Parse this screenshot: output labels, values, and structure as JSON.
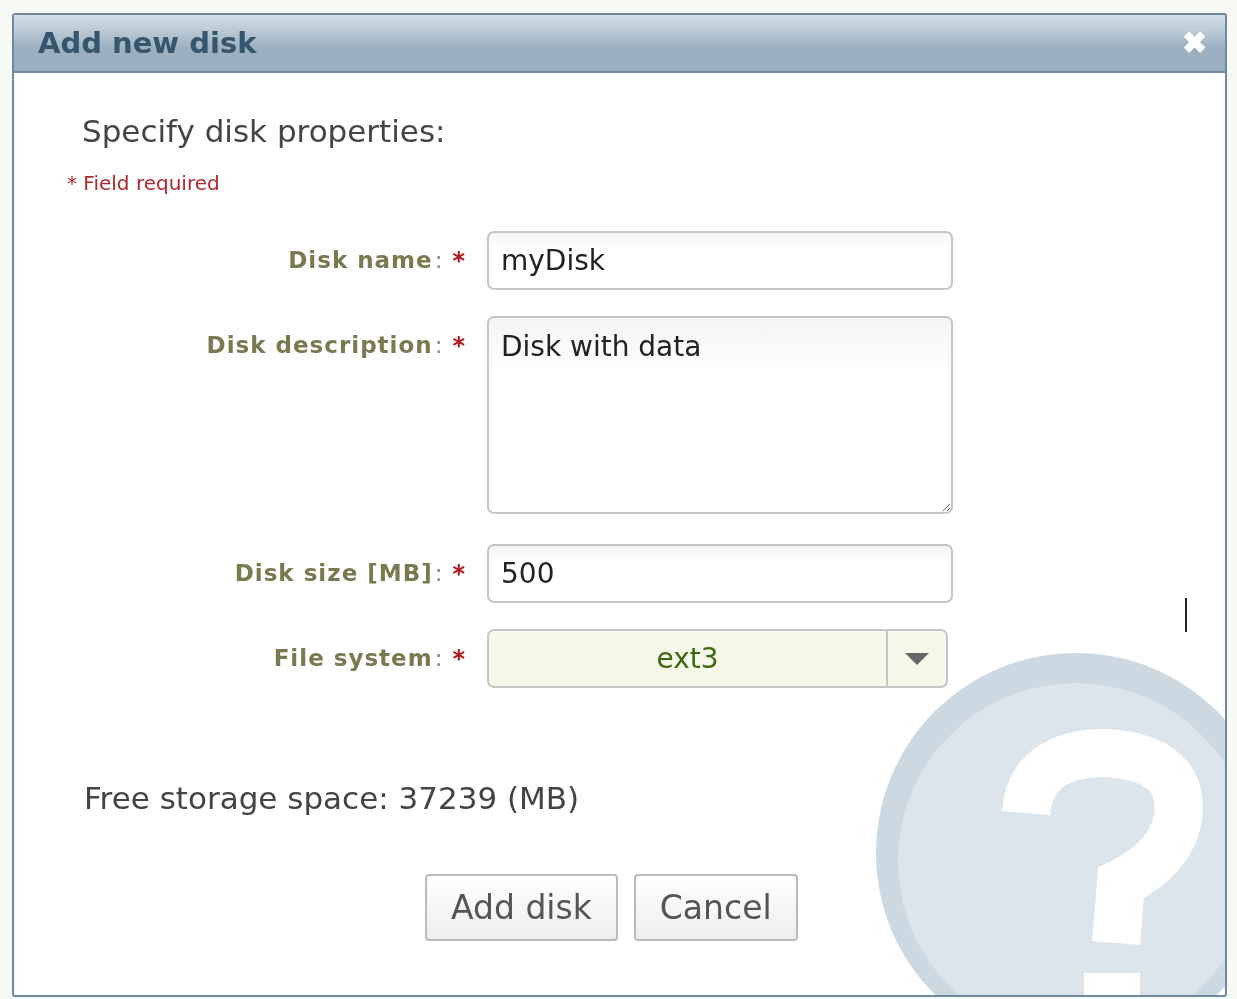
{
  "dialog": {
    "title": "Add new disk",
    "close": "✖"
  },
  "heading": "Specify disk properties:",
  "required_note": "* Field required",
  "fields": [
    {
      "kind": "text",
      "label": "Disk name",
      "suffix": ":",
      "required_mark": "*",
      "value": "myDisk"
    },
    {
      "kind": "textarea",
      "label": "Disk description",
      "suffix": ":",
      "required_mark": "*",
      "value": "Disk with data"
    },
    {
      "kind": "text",
      "label": "Disk size [MB]",
      "suffix": ":",
      "required_mark": "*",
      "value": "500"
    },
    {
      "kind": "select",
      "label": "File system",
      "suffix": ":",
      "required_mark": "*",
      "value": "ext3"
    }
  ],
  "free_space": "Free storage space: 37239 (MB)",
  "buttons": [
    "Add disk",
    "Cancel"
  ]
}
